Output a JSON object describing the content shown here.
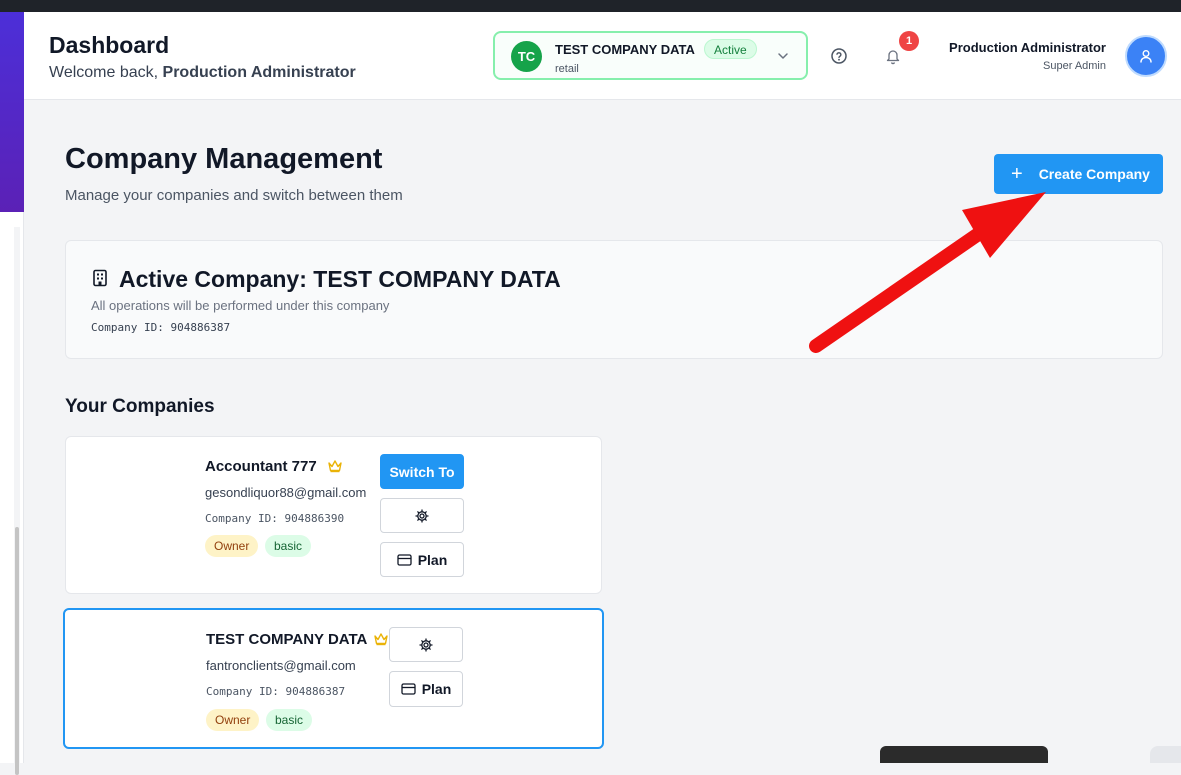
{
  "header": {
    "title": "Dashboard",
    "welcome_prefix": "Welcome back,",
    "welcome_name": "Production Administrator"
  },
  "company_switcher": {
    "initials": "TC",
    "name": "TEST COMPANY DATA",
    "status": "Active",
    "type": "retail"
  },
  "notifications": {
    "count": "1"
  },
  "user": {
    "name": "Production Administrator",
    "role": "Super Admin"
  },
  "page": {
    "title": "Company Management",
    "subtitle": "Manage your companies and switch between them",
    "create_button": "Create Company"
  },
  "active_company": {
    "title": "Active Company: TEST COMPANY DATA",
    "description": "All operations will be performed under this company",
    "id_text": "Company ID: 904886387"
  },
  "companies_section": {
    "title": "Your Companies",
    "items": [
      {
        "name": "Accountant 777",
        "email": "gesondliquor88@gmail.com",
        "id_text": "Company ID: 904886390",
        "role": "Owner",
        "plan": "basic",
        "switch_label": "Switch To",
        "plan_label": "Plan"
      },
      {
        "name": "TEST COMPANY DATA",
        "email": "fantronclients@gmail.com",
        "id_text": "Company ID: 904886387",
        "role": "Owner",
        "plan": "basic",
        "plan_label": "Plan"
      }
    ]
  },
  "colors": {
    "primary": "#2196f3",
    "success": "#16a34a",
    "annotation_arrow": "#ef1111",
    "crown": "#eab308"
  },
  "icons": [
    "building-icon",
    "crown-icon",
    "gear-icon",
    "credit-card-icon",
    "help-icon",
    "bell-icon",
    "user-icon",
    "chevron-down-icon",
    "plus-icon"
  ]
}
